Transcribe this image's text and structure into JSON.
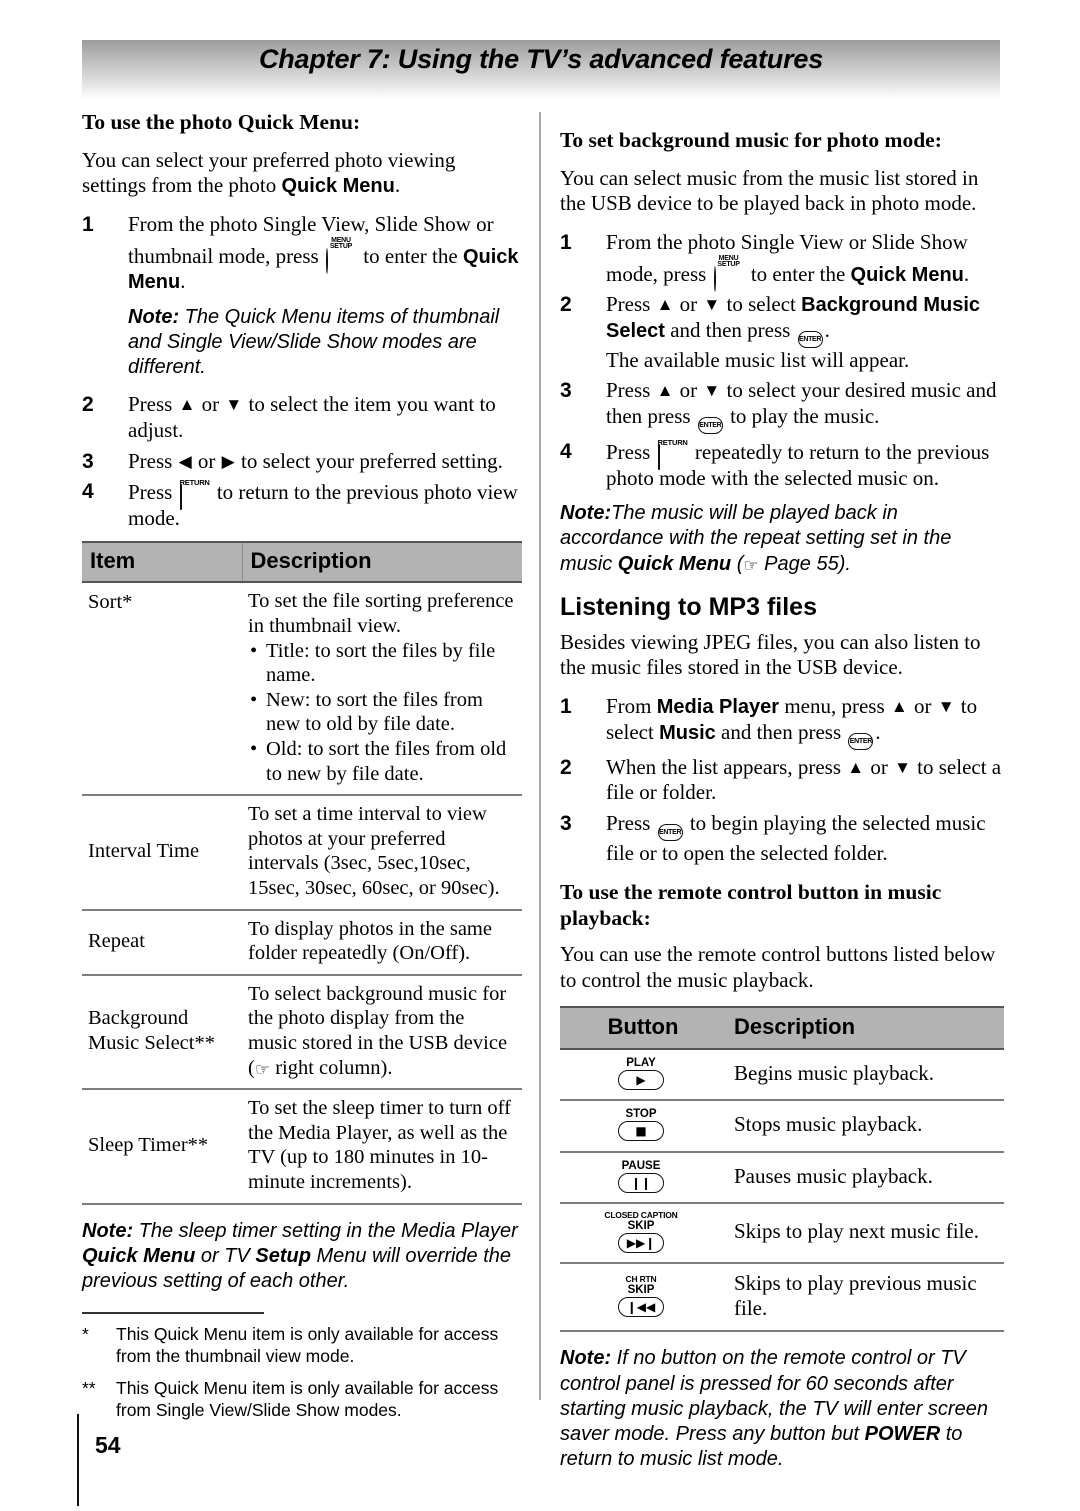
{
  "header": {
    "chapter_title": "Chapter 7: Using the TV’s advanced features"
  },
  "footer": {
    "page_number": "54"
  },
  "left_column": {
    "heading": "To use the photo Quick Menu:",
    "intro_a": "You can select your preferred photo viewing settings from the photo ",
    "intro_b": "Quick Menu",
    "intro_c": ".",
    "steps": [
      {
        "num": "1",
        "t1": "From the photo Single View, Slide Show or thumbnail mode, press ",
        "key": "menu-setup",
        "t2": " to enter the ",
        "bold": "Quick Menu",
        "t3": "."
      },
      {
        "num": "2",
        "t1": "Press ",
        "t2": " or ",
        "t3": " to select the item you want to adjust."
      },
      {
        "num": "3",
        "t1": "Press ",
        "t2": " or ",
        "t3": " to select your preferred setting."
      },
      {
        "num": "4",
        "t1": "Press ",
        "key": "return",
        "t2": " to return to the previous photo view mode."
      }
    ],
    "note_1": {
      "label": "Note:",
      "text": " The Quick Menu items of thumbnail and Single View/Slide Show modes are different."
    },
    "table": {
      "headers": [
        "Item",
        "Description"
      ],
      "rows": [
        {
          "item": "Sort*",
          "desc_lead": "To set the file sorting preference in thumbnail view.",
          "bullets": [
            "Title: to sort the files by file name.",
            "New: to sort the files from new to old by file date.",
            "Old: to sort the files from old to new by file date."
          ]
        },
        {
          "item": "Interval Time",
          "desc_lead": "To set a time interval to view photos at your preferred intervals (3sec, 5sec,10sec, 15sec, 30sec, 60sec, or 90sec).",
          "bullets": []
        },
        {
          "item": "Repeat",
          "desc_lead": "To display photos in the same folder repeatedly (On/Off).",
          "bullets": []
        },
        {
          "item": "Background Music Select**",
          "desc_lead_a": "To select background music for the photo display from the music stored in the USB device (",
          "desc_lead_b": " right column).",
          "bullets": []
        },
        {
          "item": "Sleep Timer**",
          "desc_lead": "To set the sleep timer to turn off the Media Player, as well as the TV (up to 180 minutes in 10-minute increments).",
          "bullets": []
        }
      ]
    },
    "note_2": {
      "label": "Note:",
      "t1": " The sleep timer setting in the Media Player ",
      "b1": "Quick Menu",
      "t2": " or TV ",
      "b2": "Setup",
      "t3": " Menu will override the previous setting of each other."
    },
    "footnotes": [
      {
        "marker": "*",
        "text": "This Quick Menu item is only available for access from the thumbnail view mode."
      },
      {
        "marker": "**",
        "text": "This Quick Menu item is only available for access from Single View/Slide Show modes."
      }
    ]
  },
  "right_column": {
    "heading_1": "To set background music for photo mode:",
    "intro_1": "You can select music from the music list stored in the USB device to be played back in photo mode.",
    "steps_1": [
      {
        "num": "1",
        "t1": "From the photo Single View or Slide Show mode, press ",
        "key": "menu-setup",
        "t2": " to enter the ",
        "bold": "Quick Menu",
        "t3": "."
      },
      {
        "num": "2",
        "t1": "Press ",
        "t2": " or ",
        "t3": " to select ",
        "bold": "Background Music Select",
        "t4": " and then press ",
        "key": "enter",
        "t5": ".",
        "sub": "The available music list will appear."
      },
      {
        "num": "3",
        "t1": "Press ",
        "t2": " or ",
        "t3": " to select your desired music and then press ",
        "key": "enter",
        "t4": " to play the music."
      },
      {
        "num": "4",
        "t1": "Press ",
        "key": "return",
        "t2": " repeatedly to return to the previous photo mode with the selected music on."
      }
    ],
    "note_1": {
      "label": "Note:",
      "t1": "The music will be played back in accordance with the repeat setting set in the music ",
      "b1": "Quick Menu",
      "t2": " (",
      "t3": " Page 55)."
    },
    "heading_2": "Listening to MP3 files",
    "intro_2": "Besides viewing JPEG files, you can also listen to the music files stored in the USB device.",
    "steps_2": [
      {
        "num": "1",
        "t1": "From ",
        "b1": "Media Player",
        "t2": " menu, press ",
        "t3": " or ",
        "t4": " to select ",
        "b2": "Music",
        "t5": " and then press ",
        "key": "enter",
        "t6": "."
      },
      {
        "num": "2",
        "t1": "When the list appears, press ",
        "t2": " or ",
        "t3": " to select a file or folder."
      },
      {
        "num": "3",
        "t1": "Press ",
        "key": "enter",
        "t2": " to begin playing the selected music file or to open the selected folder."
      }
    ],
    "heading_3": "To use the remote control button in music playback:",
    "intro_3": "You can use the remote control buttons listed below to control the music playback.",
    "button_table": {
      "headers": [
        "Button",
        "Description"
      ],
      "rows": [
        {
          "sup": "",
          "label": "PLAY",
          "glyph": "▶",
          "icon_name": "play-button-icon",
          "desc": "Begins music playback."
        },
        {
          "sup": "",
          "label": "STOP",
          "glyph": "■",
          "icon_name": "stop-button-icon",
          "desc": "Stops music playback."
        },
        {
          "sup": "",
          "label": "PAUSE",
          "glyph": "❙❙",
          "icon_name": "pause-button-icon",
          "desc": "Pauses music playback."
        },
        {
          "sup": "CLOSED CAPTION",
          "label": "SKIP",
          "glyph": "▶▶❙",
          "icon_name": "skip-next-button-icon",
          "desc": "Skips to play next music file."
        },
        {
          "sup": "CH RTN",
          "label": "SKIP",
          "glyph": "❙◀◀",
          "icon_name": "skip-previous-button-icon",
          "desc": "Skips to play previous music file."
        }
      ]
    },
    "note_2": {
      "label": "Note:",
      "t1": " If no button on the remote control or TV control panel is pressed for 60 seconds after starting music playback, the TV will enter screen saver mode. Press any button but ",
      "b1": "POWER",
      "t2": " to return to music list mode."
    }
  },
  "icons": {
    "menu_setup_line1": "MENU",
    "menu_setup_line2": "SETUP",
    "return_label": "RETURN",
    "enter_label": "ENTER",
    "arrow_up": "▲",
    "arrow_down": "▼",
    "arrow_left": "◀",
    "arrow_right": "▶",
    "hand_pointer": "☞"
  }
}
